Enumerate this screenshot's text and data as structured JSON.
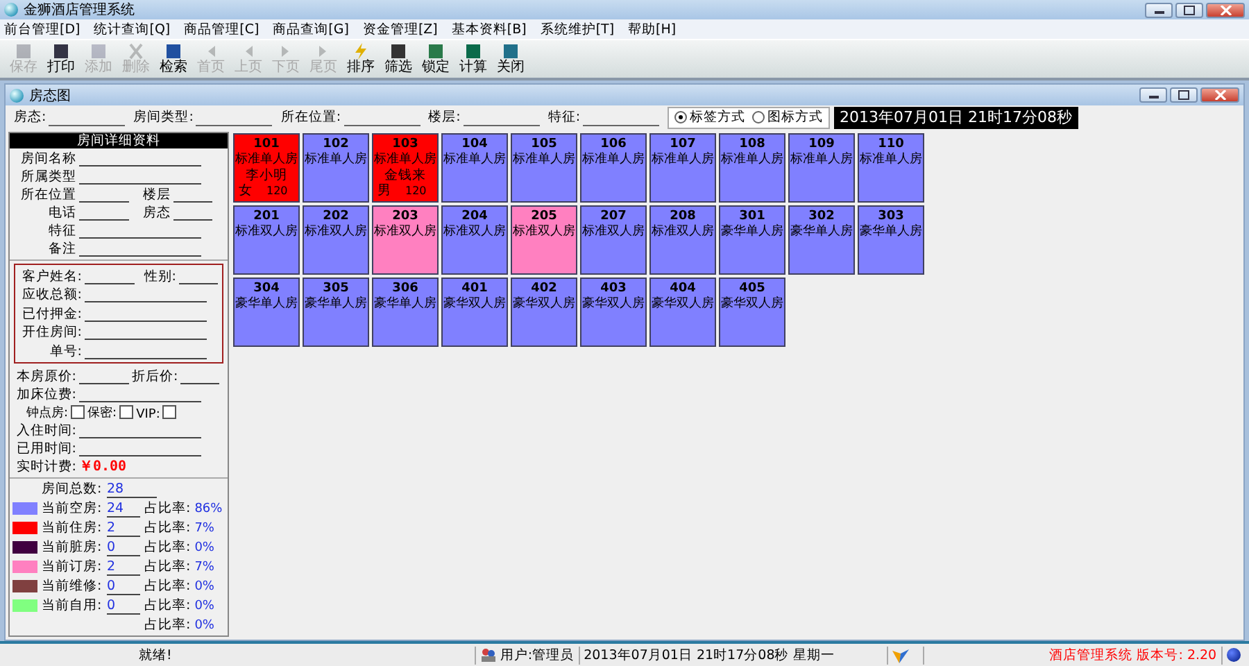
{
  "window": {
    "title": "金狮酒店管理系统"
  },
  "menu": [
    "前台管理[D]",
    "统计查询[Q]",
    "商品管理[C]",
    "商品查询[G]",
    "资金管理[Z]",
    "基本资料[B]",
    "系统维护[T]",
    "帮助[H]"
  ],
  "toolbar": [
    {
      "label": "保存",
      "kind": "save",
      "disabled": true
    },
    {
      "label": "打印",
      "kind": "print",
      "disabled": false
    },
    {
      "label": "添加",
      "kind": "add",
      "disabled": true
    },
    {
      "label": "删除",
      "kind": "delete",
      "disabled": true
    },
    {
      "label": "检索",
      "kind": "search",
      "disabled": false
    },
    {
      "label": "首页",
      "kind": "first",
      "disabled": true
    },
    {
      "label": "上页",
      "kind": "prev",
      "disabled": true
    },
    {
      "label": "下页",
      "kind": "next",
      "disabled": true
    },
    {
      "label": "尾页",
      "kind": "last",
      "disabled": true
    },
    {
      "label": "排序",
      "kind": "sort",
      "disabled": false
    },
    {
      "label": "筛选",
      "kind": "filter",
      "disabled": false
    },
    {
      "label": "锁定",
      "kind": "lock",
      "disabled": false
    },
    {
      "label": "计算",
      "kind": "calc",
      "disabled": false
    },
    {
      "label": "关闭",
      "kind": "exit",
      "disabled": false
    }
  ],
  "child_window": {
    "title": "房态图"
  },
  "filters": [
    "房态:",
    "房间类型:",
    "所在位置:",
    "楼层:",
    "特征:"
  ],
  "view_modes": [
    {
      "label": "标签方式",
      "selected": true
    },
    {
      "label": "图标方式",
      "selected": false
    }
  ],
  "clock": "2013年07月01日 21时17分08秒",
  "details": {
    "header": "房间详细资料",
    "room_fields": [
      {
        "label": "房间名称",
        "kind": "wide"
      },
      {
        "label": "所属类型",
        "kind": "wide"
      },
      {
        "label": "所在位置",
        "kind": "pair",
        "label2": "楼层"
      },
      {
        "label": "电话",
        "kind": "pair",
        "label2": "房态"
      },
      {
        "label": "特征",
        "kind": "wide"
      },
      {
        "label": "备注",
        "kind": "wide"
      }
    ],
    "guest_fields": [
      {
        "label": "客户姓名:",
        "kind": "pair",
        "label2": "性别:"
      },
      {
        "label": "应收总额:",
        "kind": "wide"
      },
      {
        "label": "已付押金:",
        "kind": "wide"
      },
      {
        "label": "开住房间:",
        "kind": "wide"
      },
      {
        "label": "单号:",
        "kind": "wide"
      }
    ],
    "price_fields": [
      {
        "label": "本房原价:",
        "kind": "pair",
        "label2": "折后价:"
      },
      {
        "label": "加床位费:",
        "kind": "wide"
      }
    ],
    "options": [
      {
        "label": "钟点房:",
        "checked": false
      },
      {
        "label": "保密:",
        "checked": false
      },
      {
        "label": "VIP:",
        "checked": false
      }
    ],
    "time_fields": [
      "入住时间:",
      "已用时间:"
    ],
    "billing": {
      "label": "实时计费:",
      "value": "￥0.00"
    }
  },
  "stats": {
    "total_label": "房间总数:",
    "total": "28",
    "rows": [
      {
        "label": "当前空房:",
        "value": "24",
        "ratio_label": "占比率:",
        "ratio": "86%",
        "color": "#8080ff"
      },
      {
        "label": "当前住房:",
        "value": "2",
        "ratio_label": "占比率:",
        "ratio": "7%",
        "color": "#ff0000"
      },
      {
        "label": "当前脏房:",
        "value": "0",
        "ratio_label": "占比率:",
        "ratio": "0%",
        "color": "#400040"
      },
      {
        "label": "当前订房:",
        "value": "2",
        "ratio_label": "占比率:",
        "ratio": "7%",
        "color": "#ff80c0"
      },
      {
        "label": "当前维修:",
        "value": "0",
        "ratio_label": "占比率:",
        "ratio": "0%",
        "color": "#804040"
      },
      {
        "label": "当前自用:",
        "value": "0",
        "ratio_label": "占比率:",
        "ratio": "0%",
        "color": "#80ff80"
      },
      {
        "ratio_label": "占比率:",
        "ratio": "0%"
      }
    ]
  },
  "rooms": [
    {
      "number": "101",
      "type": "标准单人房",
      "color": "#ff0000",
      "guest": "李小明",
      "gender": "女",
      "price": "120"
    },
    {
      "number": "102",
      "type": "标准单人房",
      "color": "#8080ff"
    },
    {
      "number": "103",
      "type": "标准单人房",
      "color": "#ff0000",
      "guest": "金钱来",
      "gender": "男",
      "price": "120"
    },
    {
      "number": "104",
      "type": "标准单人房",
      "color": "#8080ff"
    },
    {
      "number": "105",
      "type": "标准单人房",
      "color": "#8080ff"
    },
    {
      "number": "106",
      "type": "标准单人房",
      "color": "#8080ff"
    },
    {
      "number": "107",
      "type": "标准单人房",
      "color": "#8080ff"
    },
    {
      "number": "108",
      "type": "标准单人房",
      "color": "#8080ff"
    },
    {
      "number": "109",
      "type": "标准单人房",
      "color": "#8080ff"
    },
    {
      "number": "110",
      "type": "标准单人房",
      "color": "#8080ff"
    },
    {
      "number": "201",
      "type": "标准双人房",
      "color": "#8080ff"
    },
    {
      "number": "202",
      "type": "标准双人房",
      "color": "#8080ff"
    },
    {
      "number": "203",
      "type": "标准双人房",
      "color": "#ff80c0"
    },
    {
      "number": "204",
      "type": "标准双人房",
      "color": "#8080ff"
    },
    {
      "number": "205",
      "type": "标准双人房",
      "color": "#ff80c0"
    },
    {
      "number": "207",
      "type": "标准双人房",
      "color": "#8080ff"
    },
    {
      "number": "208",
      "type": "标准双人房",
      "color": "#8080ff"
    },
    {
      "number": "301",
      "type": "豪华单人房",
      "color": "#8080ff"
    },
    {
      "number": "302",
      "type": "豪华单人房",
      "color": "#8080ff"
    },
    {
      "number": "303",
      "type": "豪华单人房",
      "color": "#8080ff"
    },
    {
      "number": "304",
      "type": "豪华单人房",
      "color": "#8080ff"
    },
    {
      "number": "305",
      "type": "豪华单人房",
      "color": "#8080ff"
    },
    {
      "number": "306",
      "type": "豪华单人房",
      "color": "#8080ff"
    },
    {
      "number": "401",
      "type": "豪华双人房",
      "color": "#8080ff"
    },
    {
      "number": "402",
      "type": "豪华双人房",
      "color": "#8080ff"
    },
    {
      "number": "403",
      "type": "豪华双人房",
      "color": "#8080ff"
    },
    {
      "number": "404",
      "type": "豪华双人房",
      "color": "#8080ff"
    },
    {
      "number": "405",
      "type": "豪华双人房",
      "color": "#8080ff"
    }
  ],
  "status_bar": {
    "state": "就绪!",
    "user": "用户:管理员",
    "datetime": "2013年07月01日 21时17分08秒 星期一",
    "product": "酒店管理系统 版本号: 2.20"
  }
}
